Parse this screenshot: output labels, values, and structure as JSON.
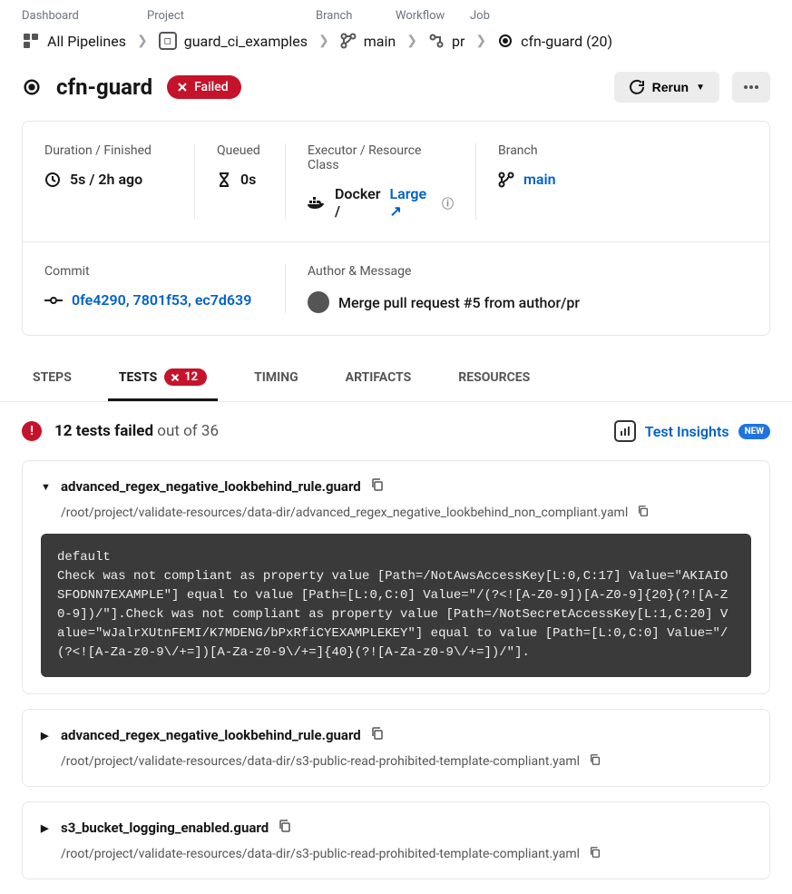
{
  "breadcrumb_headers": {
    "c0": "Dashboard",
    "c1": "Project",
    "c2": "Branch",
    "c3": "Workflow",
    "c4": "Job"
  },
  "breadcrumbs": {
    "c0": "All Pipelines",
    "c1": "guard_ci_examples",
    "c2": "main",
    "c3": "pr",
    "c4": "cfn-guard (20)"
  },
  "title": "cfn-guard",
  "status": "Failed",
  "actions": {
    "rerun": "Rerun"
  },
  "meta": {
    "duration_label": "Duration / Finished",
    "duration_value": "5s / 2h ago",
    "queued_label": "Queued",
    "queued_value": "0s",
    "executor_label": "Executor / Resource Class",
    "executor_value_prefix": "Docker / ",
    "executor_value_link": "Large",
    "branch_label": "Branch",
    "branch_value": "main",
    "commit_label": "Commit",
    "commit_value": "0fe4290, 7801f53, ec7d639",
    "author_label": "Author & Message",
    "author_value": "Merge pull request #5 from author/pr"
  },
  "tabs": {
    "steps": "STEPS",
    "tests": "TESTS",
    "tests_badge": "12",
    "timing": "TIMING",
    "artifacts": "ARTIFACTS",
    "resources": "RESOURCES"
  },
  "summary": {
    "failed_bold": "12 tests failed",
    "failed_rest": " out of 36",
    "insights": "Test Insights",
    "new": "NEW"
  },
  "tests": [
    {
      "expanded": true,
      "name": "advanced_regex_negative_lookbehind_rule.guard",
      "path": "/root/project/validate-resources/data-dir/advanced_regex_negative_lookbehind_non_compliant.yaml",
      "output": "default\nCheck was not compliant as property value [Path=/NotAwsAccessKey[L:0,C:17] Value=\"AKIAIOSFODNN7EXAMPLE\"] equal to value [Path=[L:0,C:0] Value=\"/(?<![A-Z0-9])[A-Z0-9]{20}(?![A-Z0-9])/\"].Check was not compliant as property value [Path=/NotSecretAccessKey[L:1,C:20] Value=\"wJalrXUtnFEMI/K7MDENG/bPxRfiCYEXAMPLEKEY\"] equal to value [Path=[L:0,C:0] Value=\"/(?<![A-Za-z0-9\\/+=])[A-Za-z0-9\\/+=]{40}(?![A-Za-z0-9\\/+=])/\"]."
    },
    {
      "expanded": false,
      "name": "advanced_regex_negative_lookbehind_rule.guard",
      "path": "/root/project/validate-resources/data-dir/s3-public-read-prohibited-template-compliant.yaml"
    },
    {
      "expanded": false,
      "name": "s3_bucket_logging_enabled.guard",
      "path": "/root/project/validate-resources/data-dir/s3-public-read-prohibited-template-compliant.yaml"
    }
  ]
}
